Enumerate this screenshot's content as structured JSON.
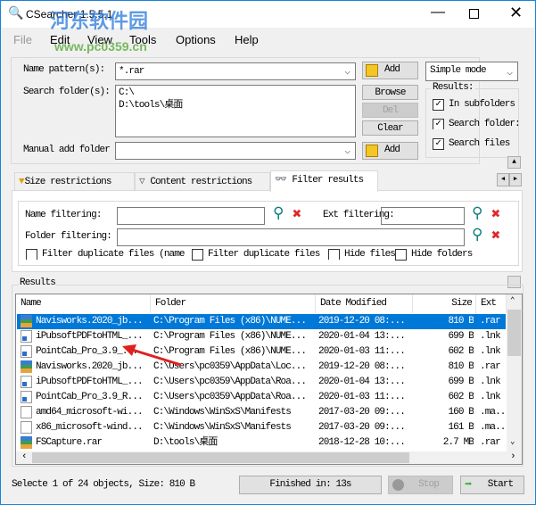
{
  "window": {
    "title": "CSearcher 1.5.5.1",
    "watermark": "河东软件园 www.pc0359.cn",
    "controls": [
      "minimize",
      "maximize",
      "close"
    ]
  },
  "menu": [
    "File",
    "Edit",
    "View",
    "Tools",
    "Options",
    "Help"
  ],
  "search": {
    "name_pattern_label": "Name pattern(s):",
    "name_pattern_value": "*.rar",
    "add_label": "Add",
    "mode": "Simple mode",
    "folders_label": "Search folder(s):",
    "folders": [
      "C:\\",
      "D:\\tools\\桌面"
    ],
    "browse_label": "Browse",
    "del_label": "Del",
    "clear_label": "Clear",
    "manual_label": "Manual add folder",
    "manual_value": "",
    "manual_add_label": "Add",
    "results_group": "Results:",
    "options": [
      {
        "label": "In subfolders",
        "checked": true
      },
      {
        "label": "Search folder:",
        "checked": true
      },
      {
        "label": "Search files",
        "checked": true
      }
    ]
  },
  "tabs": [
    {
      "label": "Size restrictions",
      "icon": "funnel-plus-icon"
    },
    {
      "label": "Content restrictions",
      "icon": "funnel-icon"
    },
    {
      "label": "Filter results",
      "icon": "binoculars-icon",
      "active": true
    }
  ],
  "filter": {
    "name_label": "Name filtering:",
    "name_value": "",
    "ext_label": "Ext filtering:",
    "ext_value": "",
    "folder_label": "Folder filtering:",
    "folder_value": "",
    "checks": [
      {
        "label": "Filter duplicate files (name",
        "checked": false
      },
      {
        "label": "Filter duplicate files",
        "checked": false
      },
      {
        "label": "Hide files",
        "checked": false
      },
      {
        "label": "Hide folders",
        "checked": false
      }
    ]
  },
  "results": {
    "label": "Results",
    "columns": [
      "Name",
      "Folder",
      "Date Modified",
      "Size",
      "Ext"
    ],
    "rows": [
      {
        "type": "rar",
        "name": "Navisworks.2020_jb...",
        "folder": "C:\\Program Files (x86)\\NUME...",
        "date": "2019-12-20 08:...",
        "size": "810 B",
        "ext": ".rar",
        "selected": true
      },
      {
        "type": "lnk",
        "name": "iPubsoftPDFtoHTML_...",
        "folder": "C:\\Program Files (x86)\\NUME...",
        "date": "2020-01-04 13:...",
        "size": "699 B",
        "ext": ".lnk"
      },
      {
        "type": "lnk",
        "name": "PointCab_Pro_3.9_...",
        "folder": "C:\\Program Files (x86)\\NUME...",
        "date": "2020-01-03 11:...",
        "size": "602 B",
        "ext": ".lnk"
      },
      {
        "type": "rar",
        "name": "Navisworks.2020_jb...",
        "folder": "C:\\Users\\pc0359\\AppData\\Loc...",
        "date": "2019-12-20 08:...",
        "size": "810 B",
        "ext": ".rar"
      },
      {
        "type": "lnk",
        "name": "iPubsoftPDFtoHTML_...",
        "folder": "C:\\Users\\pc0359\\AppData\\Roa...",
        "date": "2020-01-04 13:...",
        "size": "699 B",
        "ext": ".lnk"
      },
      {
        "type": "lnk",
        "name": "PointCab_Pro_3.9_R...",
        "folder": "C:\\Users\\pc0359\\AppData\\Roa...",
        "date": "2020-01-03 11:...",
        "size": "602 B",
        "ext": ".lnk"
      },
      {
        "type": "file",
        "name": "amd64_microsoft-wi...",
        "folder": "C:\\Windows\\WinSxS\\Manifests",
        "date": "2017-03-20 09:...",
        "size": "160 B",
        "ext": ".ma..."
      },
      {
        "type": "file",
        "name": "x86_microsoft-wind...",
        "folder": "C:\\Windows\\WinSxS\\Manifests",
        "date": "2017-03-20 09:...",
        "size": "161 B",
        "ext": ".ma..."
      },
      {
        "type": "rar",
        "name": "FSCapture.rar",
        "folder": "D:\\tools\\桌面",
        "date": "2018-12-28 10:...",
        "size": "2.7 MB",
        "ext": ".rar"
      }
    ]
  },
  "status": {
    "text": "Selecte 1 of 24 objects, Size: 810 B",
    "finished": "Finished in: 13s",
    "stop_label": "Stop",
    "start_label": "Start"
  },
  "colors": {
    "selection": "#0078d7",
    "annotation_arrow": "#e02020"
  }
}
